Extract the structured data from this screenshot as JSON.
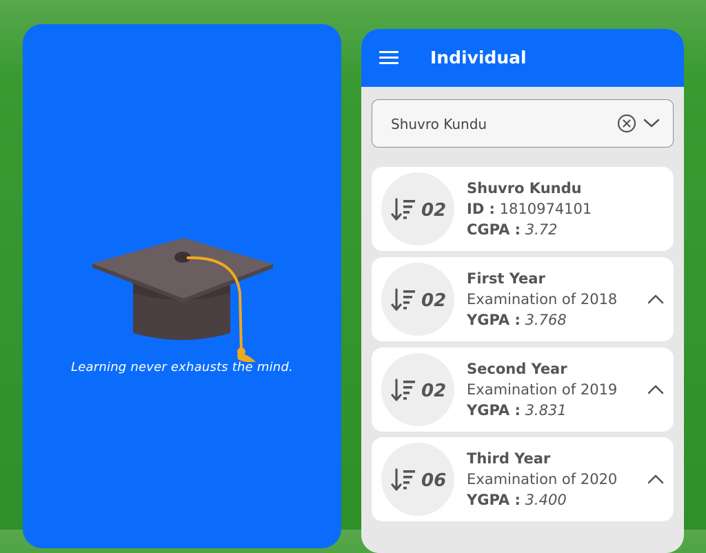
{
  "splash": {
    "tagline": "Learning never exhausts the mind.",
    "colors": {
      "background": "#0b6cfb",
      "cap": "#5c5052",
      "tassel": "#f0a81e"
    }
  },
  "appbar": {
    "menu_icon": "hamburger-menu-icon",
    "title": "Individual",
    "color": "#0b6cfb"
  },
  "search": {
    "value": "Shuvro Kundu",
    "clear_icon": "clear-circle-icon",
    "dropdown_icon": "chevron-down-icon"
  },
  "summary": {
    "badge": "02",
    "name": "Shuvro Kundu",
    "id_label": "ID :",
    "id_value": "1810974101",
    "score_label": "CGPA :",
    "score_value": "3.72"
  },
  "years": [
    {
      "badge": "02",
      "title": "First Year",
      "subtitle": "Examination of 2018",
      "score_label": "YGPA :",
      "score_value": "3.768"
    },
    {
      "badge": "02",
      "title": "Second Year",
      "subtitle": "Examination of 2019",
      "score_label": "YGPA :",
      "score_value": "3.831"
    },
    {
      "badge": "06",
      "title": "Third Year",
      "subtitle": "Examination of 2020",
      "score_label": "YGPA :",
      "score_value": "3.400"
    }
  ]
}
